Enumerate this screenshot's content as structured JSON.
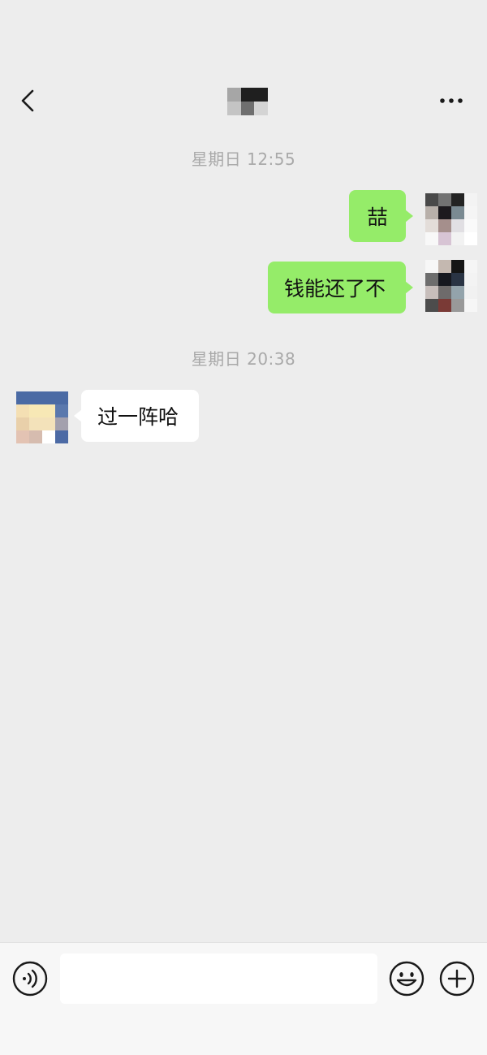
{
  "header": {
    "back_icon": "chevron-left-icon",
    "more_icon": "more-dots-icon",
    "title_mosaic_colors": [
      "#a6a6a6",
      "#1f1f1f",
      "#1f1f1f",
      "#c4c4c4",
      "#6f6f6f",
      "#d4d4d4"
    ]
  },
  "messages": [
    {
      "type": "timestamp",
      "text": "星期日 12:55"
    },
    {
      "type": "message",
      "direction": "outgoing",
      "text": "喆",
      "avatar_mosaic": [
        "#494949",
        "#727272",
        "#232323",
        "#f3f3f3",
        "#b8b0aa",
        "#1d1a1e",
        "#7a8a92",
        "#f5f5f5",
        "#e3ddd9",
        "#a58f8c",
        "#e1dfe3",
        "#fafafa",
        "#f8f8f8",
        "#d7c4d4",
        "#f2f2f2",
        "#ffffff"
      ]
    },
    {
      "type": "message",
      "direction": "outgoing",
      "text": "钱能还了不",
      "avatar_mosaic": [
        "#f7f7f7",
        "#c4b8b0",
        "#151515",
        "#f5f5f5",
        "#6d6d6d",
        "#16181f",
        "#2a3444",
        "#f3f3f3",
        "#c7bebb",
        "#6e6b6b",
        "#93a3ab",
        "#f1f1f1",
        "#4c4c4c",
        "#7a3a36",
        "#999999",
        "#f6f6f6"
      ]
    },
    {
      "type": "timestamp",
      "text": "星期日 20:38"
    },
    {
      "type": "message",
      "direction": "incoming",
      "text": "过一阵哈",
      "avatar_mosaic": [
        "#4a6aa4",
        "#4a6aa4",
        "#4a6aa4",
        "#4a6aa4",
        "#f4dfb3",
        "#f7e8b5",
        "#f7e8b5",
        "#5a78ad",
        "#e9d0aa",
        "#f3e2ba",
        "#f3e2ba",
        "#a3a0ad",
        "#e3c3b3",
        "#d6bcaf",
        "#ffffff",
        "#4c6aa5"
      ]
    }
  ],
  "input_bar": {
    "voice_icon": "voice-icon",
    "emoji_icon": "emoji-icon",
    "plus_icon": "plus-icon",
    "input_value": "",
    "input_placeholder": ""
  },
  "colors": {
    "background": "#ededed",
    "outgoing_bubble": "#95ec69",
    "incoming_bubble": "#ffffff",
    "timestamp_text": "#a9a9a9"
  }
}
